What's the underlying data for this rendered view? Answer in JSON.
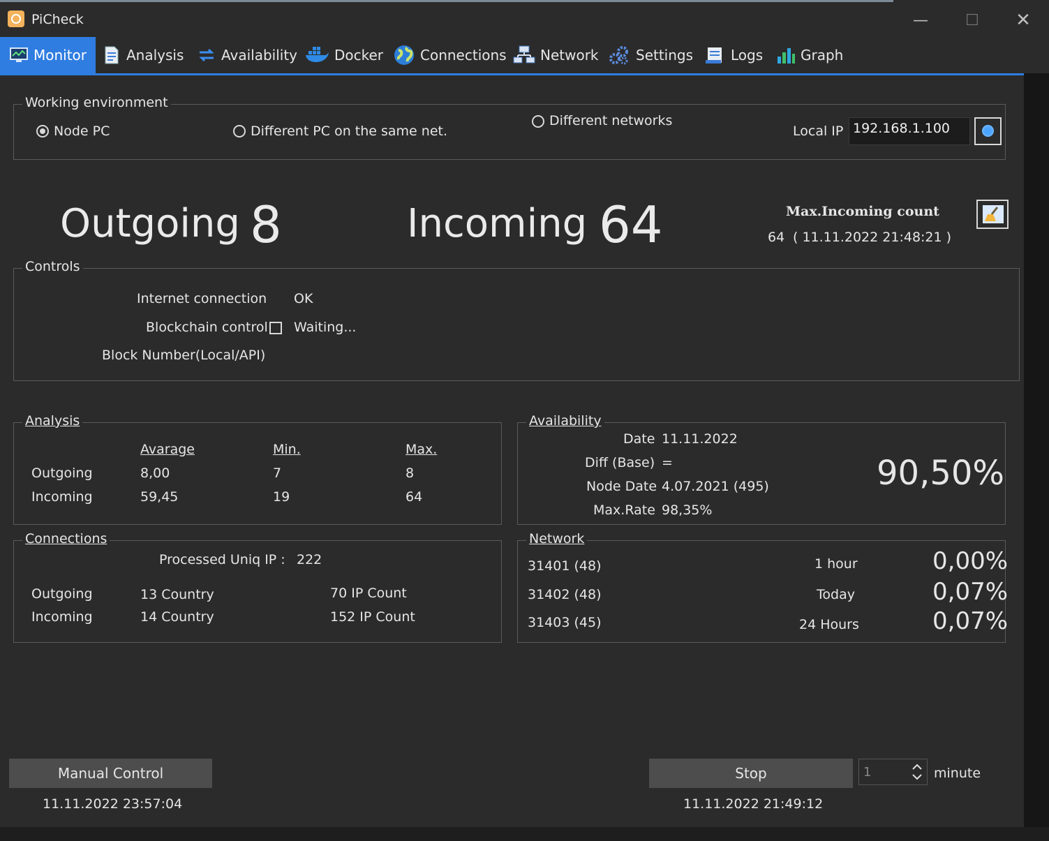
{
  "window": {
    "title": "PiCheck"
  },
  "tabs": [
    {
      "label": "Monitor",
      "icon": "monitor-icon"
    },
    {
      "label": "Analysis",
      "icon": "document-icon"
    },
    {
      "label": "Availability",
      "icon": "swap-arrows-icon"
    },
    {
      "label": "Docker",
      "icon": "docker-whale-icon"
    },
    {
      "label": "Connections",
      "icon": "globe-icon"
    },
    {
      "label": "Network",
      "icon": "network-icon"
    },
    {
      "label": "Settings",
      "icon": "gears-icon"
    },
    {
      "label": "Logs",
      "icon": "log-sheet-icon"
    },
    {
      "label": "Graph",
      "icon": "bar-graph-icon"
    }
  ],
  "environment": {
    "legend": "Working environment",
    "options": [
      "Node PC",
      "Different PC on the same net.",
      "Different networks"
    ],
    "selected": "Node PC",
    "local_ip_label": "Local IP",
    "local_ip": "192.168.1.100"
  },
  "summary": {
    "outgoing_label": "Outgoing",
    "outgoing": "8",
    "incoming_label": "Incoming",
    "incoming": "64",
    "max_incoming_title": "Max.Incoming count",
    "max_incoming_value": "64",
    "max_incoming_time": "( 11.11.2022 21:48:21 )"
  },
  "controls": {
    "legend": "Controls",
    "internet_label": "Internet connection",
    "internet_value": "OK",
    "blockchain_label": "Blockchain control",
    "blockchain_checked": false,
    "blockchain_value": "Waiting...",
    "block_number_label": "Block Number(Local/API)"
  },
  "analysis": {
    "legend": "Analysis",
    "headers": [
      "Avarage",
      "Min.",
      "Max."
    ],
    "rows": [
      {
        "label": "Outgoing",
        "avg": "8,00",
        "min": "7",
        "max": "8"
      },
      {
        "label": "Incoming",
        "avg": "59,45",
        "min": "19",
        "max": "64"
      }
    ]
  },
  "availability": {
    "legend": "Availability",
    "date_label": "Date",
    "date": "11.11.2022",
    "diff_label": "Diff (Base)",
    "diff": "=",
    "node_date_label": "Node Date",
    "node_date": "4.07.2021 (495)",
    "max_rate_label": "Max.Rate",
    "max_rate": "98,35%",
    "rate": "90,50%"
  },
  "connections": {
    "legend": "Connections",
    "processed_label": "Processed Uniq IP :",
    "processed": "222",
    "rows": [
      {
        "label": "Outgoing",
        "country": "13 Country",
        "ip": "70 IP Count"
      },
      {
        "label": "Incoming",
        "country": "14 Country",
        "ip": "152 IP Count"
      }
    ]
  },
  "network": {
    "legend": "Network",
    "ports": [
      "31401 (48)",
      "31402 (48)",
      "31403 (45)"
    ],
    "periods": [
      {
        "label": "1 hour",
        "value": "0,00%"
      },
      {
        "label": "Today",
        "value": "0,07%"
      },
      {
        "label": "24 Hours",
        "value": "0,07%"
      }
    ]
  },
  "footer": {
    "manual_label": "Manual Control",
    "manual_time": "11.11.2022 23:57:04",
    "stop_label": "Stop",
    "interval_value": "1",
    "interval_unit": "minute",
    "stop_time": "11.11.2022 21:49:12"
  },
  "colors": {
    "accent": "#2f7de1",
    "background": "#2b2b2b"
  }
}
